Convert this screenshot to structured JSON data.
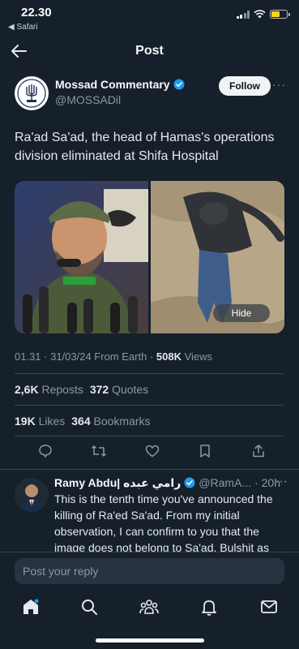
{
  "status_bar": {
    "time": "22.30",
    "back_app": "◀ Safari"
  },
  "nav": {
    "title": "Post"
  },
  "author": {
    "name": "Mossad Commentary",
    "handle": "@MOSSADil",
    "follow_label": "Follow",
    "more": "···"
  },
  "post": {
    "text": "Ra'ad Sa'ad, the head of Hamas's operations division eliminated at Shifa Hospital",
    "hide_label": "Hide"
  },
  "meta": {
    "time_date_source": "01.31 · 31/03/24 From Earth · ",
    "views_count": "508K",
    "views_label": " Views"
  },
  "stats": {
    "reposts_count": "2,6K",
    "reposts_label": "Reposts",
    "quotes_count": "372",
    "quotes_label": "Quotes",
    "likes_count": "19K",
    "likes_label": "Likes",
    "bookmarks_count": "364",
    "bookmarks_label": "Bookmarks"
  },
  "reply": {
    "name": "Ramy Abdu| رامي عبده",
    "handle": "@RamA...",
    "time": "· 20h",
    "more": "···",
    "text": "This is the tenth time you've announced the killing of Ra'ed Sa'ad. From my initial observation, I can confirm to you that the image does not belong to Sa'ad. Bulshit as"
  },
  "composer": {
    "placeholder": "Post your reply"
  },
  "tabs": [
    "home-icon",
    "search-icon",
    "communities-icon",
    "notifications-icon",
    "messages-icon"
  ],
  "colors": {
    "background": "#15202b",
    "verified": "#1d9bf0",
    "muted": "#8b98a5",
    "battery": "#ffd60a"
  }
}
